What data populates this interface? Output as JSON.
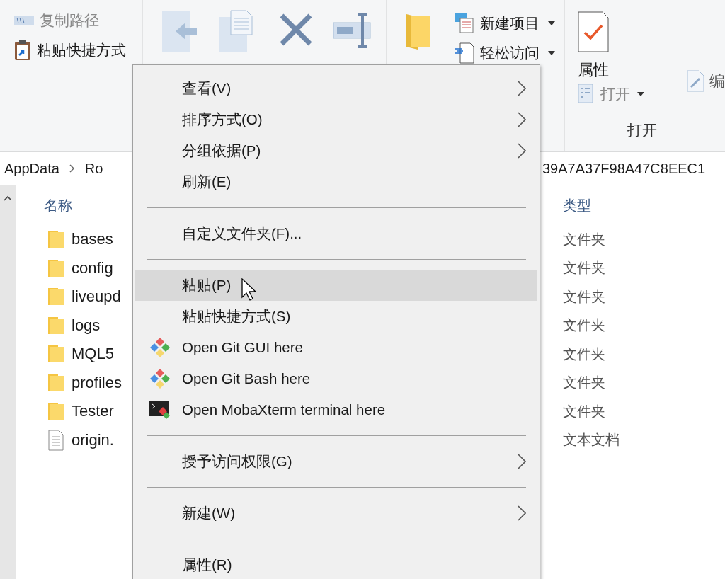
{
  "ribbon": {
    "clipboard": [
      {
        "label": "复制路径",
        "disabled": true
      },
      {
        "label": "粘贴快捷方式",
        "disabled": false
      }
    ],
    "new_items": [
      {
        "label": "新建项目"
      },
      {
        "label": "轻松访问"
      }
    ],
    "properties": "属性",
    "open": {
      "label": "打开",
      "disabled": true
    },
    "open_group_label": "打开",
    "edit": "编"
  },
  "address": {
    "segments": [
      "AppData",
      "Ro"
    ],
    "tail": "39A7A37F98A47C8EEC1"
  },
  "columns": [
    "名称",
    "类型"
  ],
  "files": [
    {
      "name": "bases",
      "type": "文件夹",
      "kind": "folder"
    },
    {
      "name": "config",
      "type": "文件夹",
      "kind": "folder"
    },
    {
      "name": "liveupd",
      "type": "文件夹",
      "kind": "folder"
    },
    {
      "name": "logs",
      "type": "文件夹",
      "kind": "folder"
    },
    {
      "name": "MQL5",
      "type": "文件夹",
      "kind": "folder"
    },
    {
      "name": "profiles",
      "type": "文件夹",
      "kind": "folder"
    },
    {
      "name": "Tester",
      "type": "文件夹",
      "kind": "folder"
    },
    {
      "name": "origin.",
      "type": "文本文档",
      "kind": "text"
    }
  ],
  "context_menu": [
    {
      "kind": "item",
      "label": "查看(V)",
      "submenu": true,
      "selected": false
    },
    {
      "kind": "item",
      "label": "排序方式(O)",
      "submenu": true,
      "selected": false
    },
    {
      "kind": "item",
      "label": "分组依据(P)",
      "submenu": true,
      "selected": false
    },
    {
      "kind": "item",
      "label": "刷新(E)",
      "submenu": false,
      "selected": false
    },
    {
      "kind": "separator"
    },
    {
      "kind": "item",
      "label": "自定义文件夹(F)...",
      "submenu": false,
      "selected": false
    },
    {
      "kind": "separator"
    },
    {
      "kind": "item",
      "label": "粘贴(P)",
      "submenu": false,
      "selected": true
    },
    {
      "kind": "item",
      "label": "粘贴快捷方式(S)",
      "submenu": false,
      "selected": false
    },
    {
      "kind": "git",
      "label": "Open Git GUI here",
      "submenu": false,
      "selected": false
    },
    {
      "kind": "git",
      "label": "Open Git Bash here",
      "submenu": false,
      "selected": false
    },
    {
      "kind": "terminal",
      "label": "Open MobaXterm terminal here",
      "submenu": false,
      "selected": false
    },
    {
      "kind": "separator"
    },
    {
      "kind": "item",
      "label": "授予访问权限(G)",
      "submenu": true,
      "selected": false
    },
    {
      "kind": "separator"
    },
    {
      "kind": "item",
      "label": "新建(W)",
      "submenu": true,
      "selected": false
    },
    {
      "kind": "separator"
    },
    {
      "kind": "item",
      "label": "属性(R)",
      "submenu": false,
      "selected": false
    }
  ]
}
